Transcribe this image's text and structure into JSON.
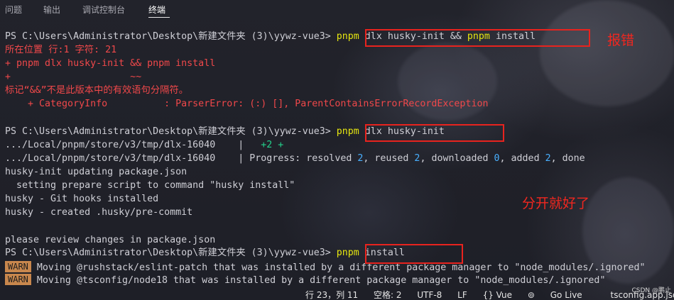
{
  "tabs": [
    "问题",
    "输出",
    "调试控制台",
    "终端"
  ],
  "active_tab": "终端",
  "terminal": {
    "block1": {
      "prompt": "PS C:\\Users\\Administrator\\Desktop\\新建文件夹 (3)\\yywz-vue3> ",
      "cmd_pnpm": "pnpm",
      "cmd_rest": " dlx husky-init && ",
      "cmd_pnpm2": "pnpm",
      "cmd_install": " install",
      "err1": "所在位置 行:1 字符: 21",
      "err2": "+ pnpm dlx husky-init && pnpm install",
      "err3": "+                     ~~",
      "err4": "标记“&&”不是此版本中的有效语句分隔符。",
      "err5": "    + CategoryInfo          : ParserError: (:) [], ParentContainsErrorRecordException"
    },
    "block2": {
      "prompt": "PS C:\\Users\\Administrator\\Desktop\\新建文件夹 (3)\\yywz-vue3> ",
      "cmd_pnpm": "pnpm",
      "cmd_rest": " dlx husky-init",
      "dlx1_path": ".../Local/pnpm/store/v3/tmp/dlx-16040    |   ",
      "dlx1_plus": "+2 +",
      "dlx2_path": ".../Local/pnpm/store/v3/tmp/dlx-16040    | Progress: resolved ",
      "resolved": "2",
      "reused_label": ", reused ",
      "reused": "2",
      "downloaded_label": ", downloaded ",
      "downloaded": "0",
      "added_label": ", added ",
      "added": "2",
      "done_label": ", done",
      "l1": "husky-init updating package.json",
      "l2": "  setting prepare script to command \"husky install\"",
      "l3": "husky - Git hooks installed",
      "l4": "husky - created .husky/pre-commit",
      "l5": "please review changes in package.json"
    },
    "block3": {
      "prompt": "PS C:\\Users\\Administrator\\Desktop\\新建文件夹 (3)\\yywz-vue3> ",
      "cmd_pnpm": "pnpm",
      "cmd_rest": " install",
      "warn_label": "WARN",
      "warn1": "Moving @rushstack/eslint-patch that was installed by a different package manager to \"node_modules/.ignored\"",
      "warn2": "Moving @tsconfig/node18 that was installed by a different package manager to \"node_modules/.ignored\""
    }
  },
  "annotations": {
    "error_note": "报错",
    "fix_note": "分开就好了"
  },
  "statusbar": {
    "ln": "行 23，列 11",
    "spaces": "空格: 2",
    "encoding": "UTF-8",
    "eol": "LF",
    "language": "{} Vue",
    "golive": "Go Live",
    "file": "tsconfig.app.json"
  },
  "watermark": "CSDN @鹏止",
  "colors": {
    "annotation_red": "#e8231e",
    "error_text": "#f0484a",
    "command_yellow": "#e5e510",
    "number_blue": "#49b0ff",
    "green": "#23d18b",
    "warn_bg": "#c8874d"
  }
}
